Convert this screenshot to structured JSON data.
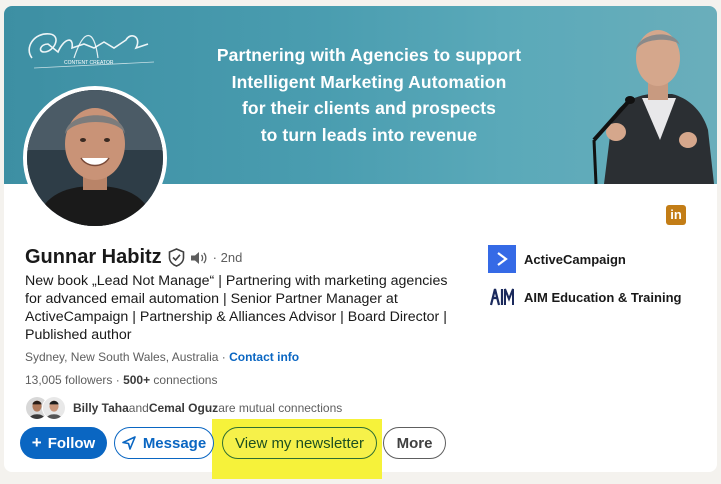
{
  "banner": {
    "logo_script": "Gunnar Habitz",
    "logo_sub": "CONTENT CREATOR",
    "headline_lines": [
      "Partnering with Agencies to support",
      "Intelligent Marketing Automation",
      "for their clients and prospects",
      "to turn leads into revenue"
    ]
  },
  "profile": {
    "name": "Gunnar Habitz",
    "degree": "· 2nd",
    "headline": "New book „Lead Not Manage“ | Partnering with marketing agencies for advanced email automation | Senior Partner Manager at ActiveCampaign | Partnership & Alliances Advisor | Board Director | Published author",
    "location": "Sydney, New South Wales, Australia",
    "location_sep": " · ",
    "contact_link": "Contact info",
    "followers_count": "13,005",
    "followers_label": " followers",
    "connections_sep": " · ",
    "connections_count": "500+",
    "connections_label": " connections",
    "mutual_name_1": "Billy Taha",
    "mutual_and": " and ",
    "mutual_name_2": "Cemal Oguz",
    "mutual_suffix": " are mutual connections"
  },
  "companies": [
    {
      "name": "ActiveCampaign",
      "icon": "activecampaign-logo"
    },
    {
      "name": "AIM Education & Training",
      "icon": "aim-logo"
    }
  ],
  "actions": {
    "follow": "Follow",
    "follow_icon": "+",
    "message": "Message",
    "newsletter": "View my newsletter",
    "more": "More"
  },
  "badges": {
    "linkedin": "in"
  },
  "colors": {
    "accent": "#0a66c2",
    "banner": "#4a9db0",
    "highlight": "#f6f23a",
    "ac_blue": "#356ae6"
  }
}
